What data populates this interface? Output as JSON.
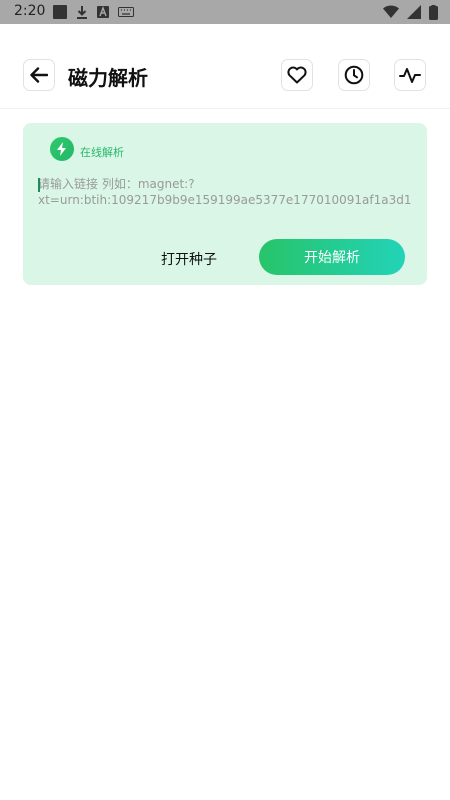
{
  "status_bar": {
    "time": "2:20"
  },
  "header": {
    "title": "磁力解析"
  },
  "card": {
    "badge_label": "在线解析",
    "input_value": "",
    "input_placeholder": "请输入链接 列如：magnet:?xt=urn:btih:109217b9b9e159199ae5377e177010091af1a3d1",
    "open_seed_label": "打开种子",
    "start_button_label": "开始解析"
  },
  "colors": {
    "accent": "#28c46e",
    "card_bg": "#d9f6e6",
    "button_gradient_start": "#27c469",
    "button_gradient_end": "#22d3b8"
  }
}
